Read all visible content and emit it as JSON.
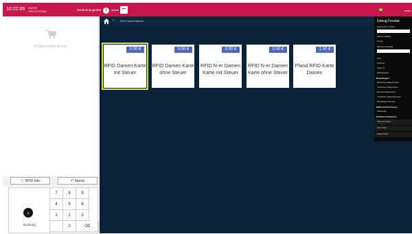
{
  "header": {
    "time": "10:22:05",
    "brand_line1": "KASSE",
    "brand_line2": "TESTSYSTEM",
    "register_label": "Kantinenauge2de",
    "user_initial": "i",
    "user_name": "admin",
    "minus_label": "−",
    "right_text": "close",
    "accent_color": "#c8174f"
  },
  "cart": {
    "empty_text": "Ihr Warenkorb ist leer."
  },
  "actions": {
    "rfid_info": "RFID Info",
    "storno": "Storno"
  },
  "keypad": {
    "book_label": "Buchung",
    "keys": [
      "7",
      "8",
      "9",
      "4",
      "5",
      "6",
      "1",
      "2",
      "3",
      "",
      "0",
      "⌫"
    ]
  },
  "breadcrumb": {
    "path": "RFID Karte Damen"
  },
  "tiles": [
    {
      "price": "0.00 €",
      "name": "RFID Damen Karte mit Steuer",
      "selected": true
    },
    {
      "price": "0.00 €",
      "name": "RFID Damen Karte ohne Steuer",
      "selected": false
    },
    {
      "price": "0.00 €",
      "name": "RFID N-er Damen Karte mit Steuer",
      "selected": false
    },
    {
      "price": "0.00 €",
      "name": "RFID N-er Damen Karte ohne Steuer",
      "selected": false
    },
    {
      "price": "1.00 €",
      "name": "Pfand RFID Karte Damen",
      "selected": false
    }
  ],
  "debug": {
    "title": "Debug Fenster",
    "items": [
      "Elektronische Vorbdeli",
      "Datenstr auflisten",
      "Senden",
      "Nächste Liefergrüße",
      "Sens",
      "Sende ID",
      "Sende ID",
      "RFID Eingeben",
      "Bestellungen",
      "Bestellung auflegen/löschen",
      "Unbestellte auflegen/lesen",
      "Bestellte auflegen/lesen",
      "Unbestellte auflegen/beenden",
      "Bestellungen/ bestellen",
      "Elektronischer Kasse",
      "Wiedergabe",
      "Hardware Ereignisse",
      "Öffnen der Kasse",
      "Nur drucken",
      "Design ändern"
    ]
  }
}
